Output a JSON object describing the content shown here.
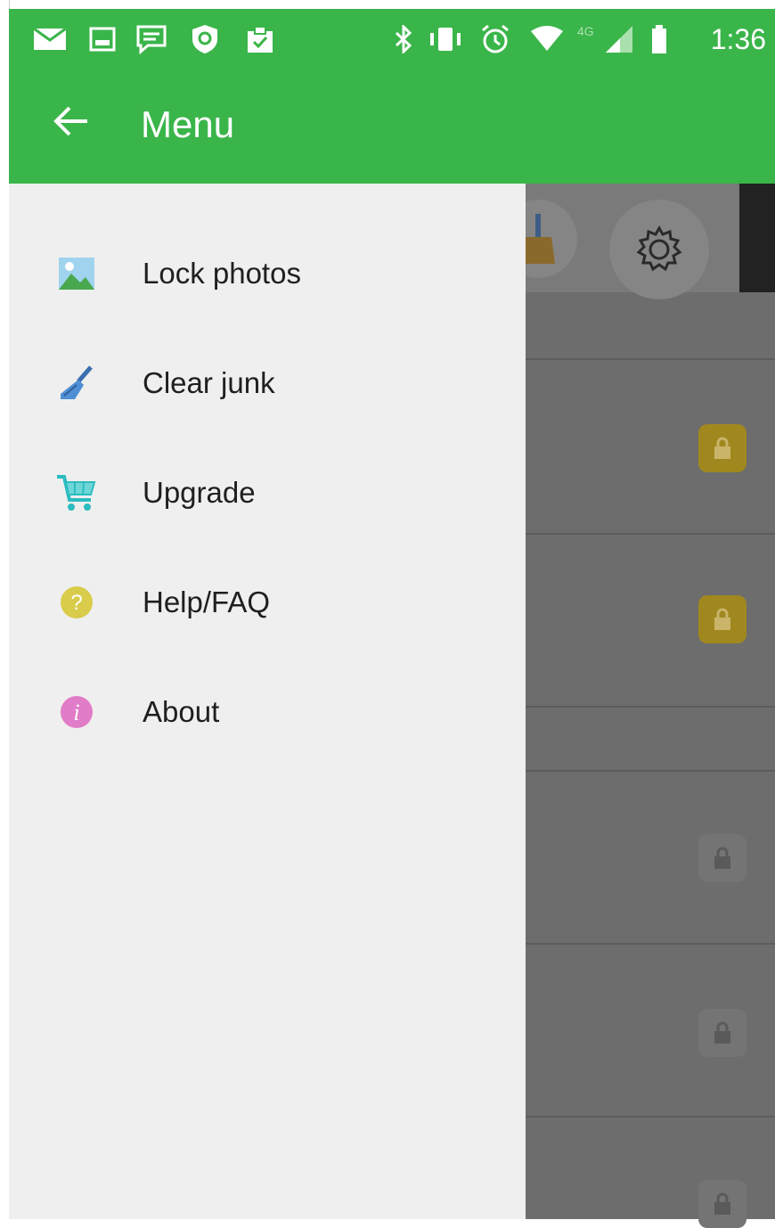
{
  "status_bar": {
    "time": "1:36",
    "network": "4G"
  },
  "app_bar": {
    "title": "Menu"
  },
  "drawer": {
    "items": [
      {
        "label": "Lock photos",
        "icon": "image-icon"
      },
      {
        "label": "Clear junk",
        "icon": "broom-icon"
      },
      {
        "label": "Upgrade",
        "icon": "cart-icon"
      },
      {
        "label": "Help/FAQ",
        "icon": "help-icon"
      },
      {
        "label": "About",
        "icon": "info-icon"
      }
    ]
  },
  "colors": {
    "primary": "#3ab54a",
    "drawer_bg": "#efefef",
    "lock_accent": "#e6c200"
  }
}
